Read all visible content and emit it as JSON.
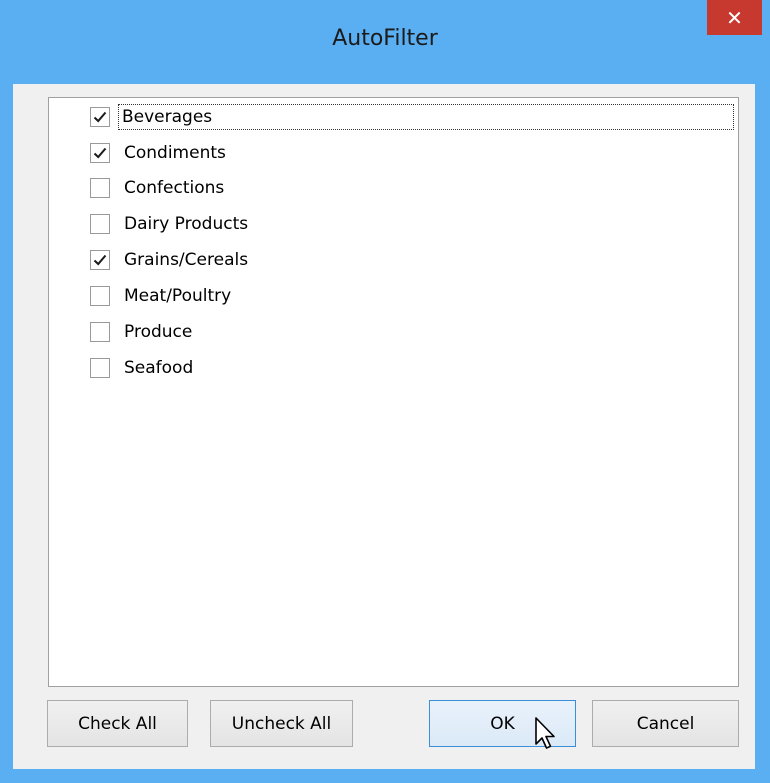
{
  "window": {
    "title": "AutoFilter",
    "close_glyph": "✕",
    "accent_color": "#5aaef2",
    "close_color": "#c7392e"
  },
  "filter_list": {
    "items": [
      {
        "label": "Beverages",
        "checked": true
      },
      {
        "label": "Condiments",
        "checked": true
      },
      {
        "label": "Confections",
        "checked": false
      },
      {
        "label": "Dairy Products",
        "checked": false
      },
      {
        "label": "Grains/Cereals",
        "checked": true
      },
      {
        "label": "Meat/Poultry",
        "checked": false
      },
      {
        "label": "Produce",
        "checked": false
      },
      {
        "label": "Seafood",
        "checked": false
      }
    ]
  },
  "buttons": {
    "check_all": "Check All",
    "uncheck_all": "Uncheck All",
    "ok": "OK",
    "cancel": "Cancel"
  }
}
